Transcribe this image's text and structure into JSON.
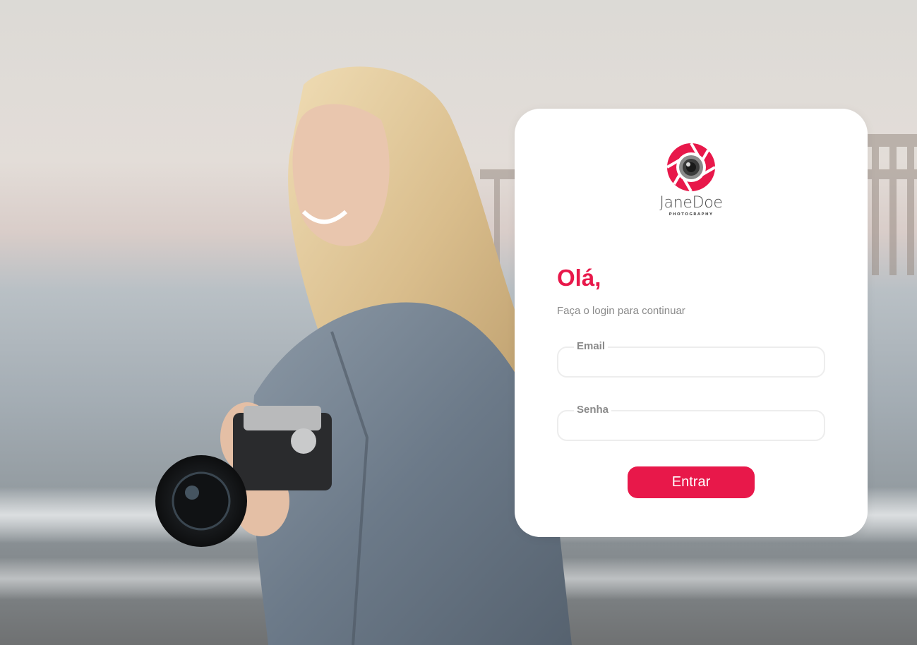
{
  "background": {
    "description_icon": "photographer-background-image"
  },
  "brand": {
    "name": "JaneDoe",
    "tagline": "PHOTOGRAPHY",
    "logo_icon": "camera-lens-icon",
    "accent_color": "#e8184a"
  },
  "login": {
    "greeting": "Olá,",
    "subtitle": "Faça o login para continuar",
    "email_label": "Email",
    "email_value": "",
    "password_label": "Senha",
    "password_value": "",
    "submit_label": "Entrar"
  }
}
